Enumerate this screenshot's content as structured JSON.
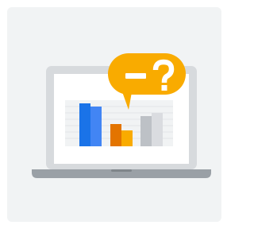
{
  "illustration": {
    "description_icon": "laptop-with-bar-chart-and-question-bubble",
    "bubble_text": "−?",
    "colors": {
      "card": "#f1f3f4",
      "laptop_body": "#d7dadd",
      "laptop_base": "#9aa0a6",
      "screen": "#ffffff",
      "grid": "#e8eaed",
      "bar_blue_dark": "#1a73e8",
      "bar_blue_light": "#4285f4",
      "bar_orange_dark": "#e37400",
      "bar_orange_light": "#f9ab00",
      "bar_gray_dark": "#bdc1c6",
      "bar_gray_light": "#dadce0",
      "bubble": "#f9ab00",
      "bubble_text": "#ffffff"
    }
  }
}
